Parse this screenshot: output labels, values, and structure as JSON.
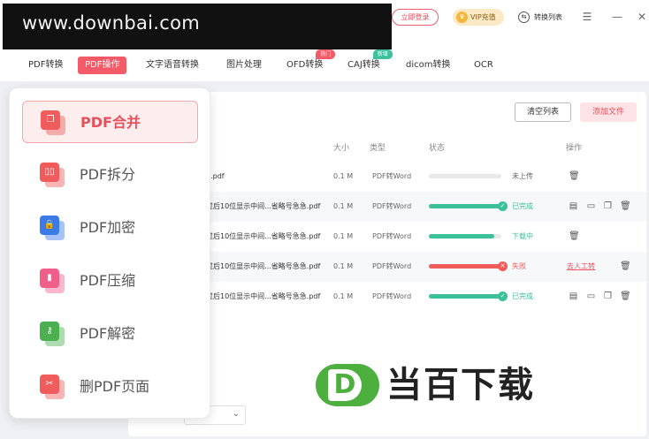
{
  "titlebar": {
    "watermark_url": "www.downbai.com",
    "login_label": "立即登录",
    "vip_label": "VIP充值",
    "convert_list_label": "转换列表",
    "icons": [
      "crown-icon",
      "convert-list-icon",
      "menu-icon",
      "minimize-icon",
      "close-icon"
    ]
  },
  "nav": {
    "tabs": [
      {
        "label": "PDF转换"
      },
      {
        "label": "PDF操作"
      },
      {
        "label": "文字语音转换"
      },
      {
        "label": "图片处理"
      },
      {
        "label": "OFD转换",
        "badge": "热门"
      },
      {
        "label": "CAJ转换",
        "badge": "新增"
      },
      {
        "label": "dicom转换"
      },
      {
        "label": "OCR"
      }
    ],
    "badge_colors": {
      "hot": "#f25b67",
      "new": "#3fbf9f"
    }
  },
  "toolbar": {
    "clear_label": "清空列表",
    "add_label": "添加文件"
  },
  "table": {
    "headers": {
      "size": "大小",
      "type": "类型",
      "status": "状态",
      "ops": "操作"
    },
    "rows": [
      {
        "name": "0.pdf",
        "size": "0.1 M",
        "type": "PDF转Word",
        "progress": 0,
        "status": "未上传",
        "state": "idle"
      },
      {
        "name": "过后10位显示中间...省略号急急.pdf",
        "size": "0.1 M",
        "type": "PDF转Word",
        "progress": 1.0,
        "status": "已完成",
        "state": "done"
      },
      {
        "name": "过后10位显示中间...省略号急急.pdf",
        "size": "0.1 M",
        "type": "PDF转Word",
        "progress": 0.9,
        "status": "下载中",
        "state": "downloading"
      },
      {
        "name": "过后10位显示中间...省略号急急.pdf",
        "size": "0.1 M",
        "type": "PDF转Word",
        "progress": 1.0,
        "status": "失败",
        "state": "failed",
        "op_link": "去人工转"
      },
      {
        "name": "过后10位显示中间...省略号急急.pdf",
        "size": "0.1 M",
        "type": "PDF转Word",
        "progress": 1.0,
        "status": "已完成",
        "state": "done"
      }
    ],
    "colors": {
      "done": "#3cc09a",
      "failed": "#f05b5b",
      "idle": "#888888"
    }
  },
  "dropdown": {
    "items": [
      {
        "label": "PDF合并",
        "icon": "merge-icon",
        "color": "#f05b5b",
        "glyph": "❐",
        "active": true
      },
      {
        "label": "PDF拆分",
        "icon": "split-icon",
        "color": "#f05b5b",
        "glyph": "▯▯"
      },
      {
        "label": "PDF加密",
        "icon": "lock-icon",
        "color": "#3b7be8",
        "glyph": "🔒"
      },
      {
        "label": "PDF压缩",
        "icon": "compress-icon",
        "color": "#ef5f8a",
        "glyph": "▮"
      },
      {
        "label": "PDF解密",
        "icon": "key-icon",
        "color": "#4caf50",
        "glyph": "⚷"
      },
      {
        "label": "删PDF页面",
        "icon": "scissors-icon",
        "color": "#f05b5b",
        "glyph": "✂"
      }
    ]
  },
  "logo": {
    "mark": "D",
    "text": "当百下载"
  }
}
